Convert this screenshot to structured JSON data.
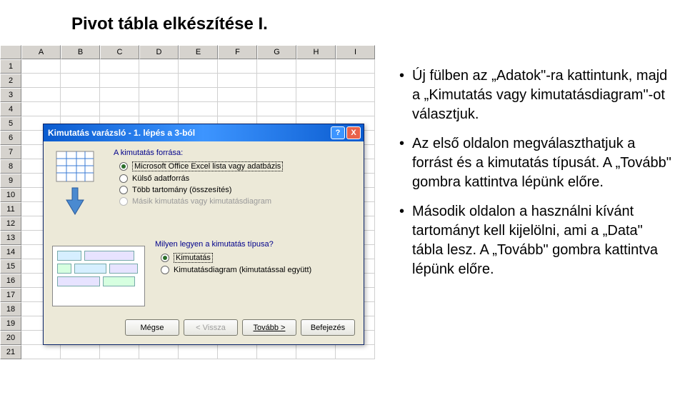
{
  "page": {
    "title": "Pivot tábla elkészítése I."
  },
  "spreadsheet": {
    "columns": [
      "A",
      "B",
      "C",
      "D",
      "E",
      "F",
      "G",
      "H",
      "I"
    ],
    "rows": [
      "1",
      "2",
      "3",
      "4",
      "5",
      "6",
      "7",
      "8",
      "9",
      "10",
      "11",
      "12",
      "13",
      "14",
      "15",
      "16",
      "17",
      "18",
      "19",
      "20",
      "21"
    ]
  },
  "dialog": {
    "title": "Kimutatás varázsló - 1. lépés a 3-ból",
    "help_label": "?",
    "close_label": "X",
    "source_question": "A kimutatás forrása:",
    "source_options": [
      {
        "label": "Microsoft Office Excel lista vagy adatbázis",
        "selected": true,
        "disabled": false
      },
      {
        "label": "Külső adatforrás",
        "selected": false,
        "disabled": false
      },
      {
        "label": "Több tartomány (összesítés)",
        "selected": false,
        "disabled": false
      },
      {
        "label": "Másik kimutatás vagy kimutatásdiagram",
        "selected": false,
        "disabled": true
      }
    ],
    "type_question": "Milyen legyen a kimutatás típusa?",
    "type_options": [
      {
        "label": "Kimutatás",
        "selected": true,
        "disabled": false
      },
      {
        "label": "Kimutatásdiagram (kimutatással együtt)",
        "selected": false,
        "disabled": false
      }
    ],
    "buttons": {
      "cancel": "Mégse",
      "back": "< Vissza",
      "next": "Tovább >",
      "finish": "Befejezés"
    }
  },
  "notes": {
    "b1": "Új fülben az „Adatok\"-ra kattintunk, majd a „Kimutatás vagy kimutatásdiagram\"-ot választjuk.",
    "b2": "Az első oldalon megválaszthatjuk a forrást és a kimutatás típusát. A „Tovább\" gombra kattintva lépünk előre.",
    "b3": "Második oldalon a használni kívánt tartományt kell kijelölni, ami a „Data\" tábla lesz. A „Tovább\" gombra kattintva lépünk előre."
  }
}
